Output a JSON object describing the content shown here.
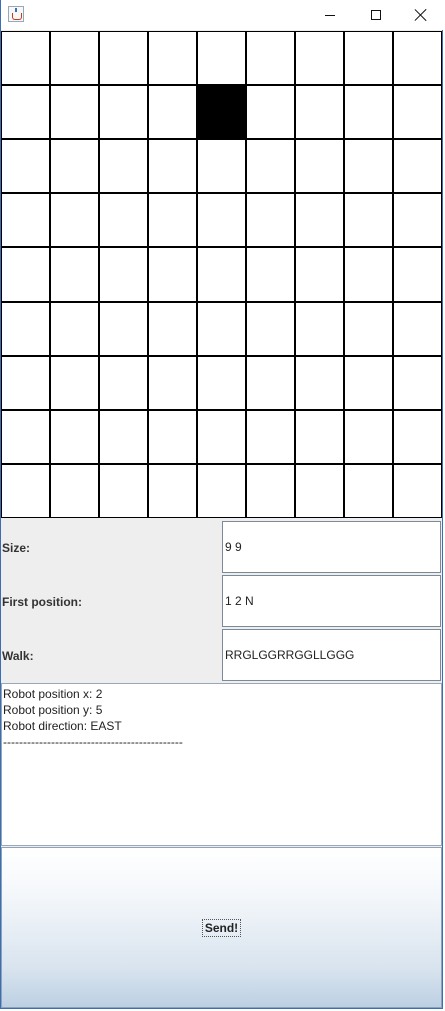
{
  "window": {
    "title": "",
    "app_icon": "java-icon",
    "controls": [
      "minimize-icon",
      "maximize-icon",
      "close-icon"
    ]
  },
  "grid": {
    "rows": 9,
    "columns": 9,
    "filled_cells": [
      {
        "row": 2,
        "col": 5
      }
    ],
    "filled_color": "#000000",
    "empty_color": "#ffffff"
  },
  "form": {
    "size": {
      "label": "Size:",
      "value": "9 9"
    },
    "first_position": {
      "label": "First position:",
      "value": "1 2 N"
    },
    "walk": {
      "label": "Walk:",
      "value": "RRGLGGRRGGLLGGG"
    }
  },
  "output": {
    "lines": [
      "Robot position x: 2",
      "Robot position y: 5",
      "Robot direction: EAST",
      "---------------------------------------------"
    ]
  },
  "send_button": {
    "label": "Send!"
  }
}
